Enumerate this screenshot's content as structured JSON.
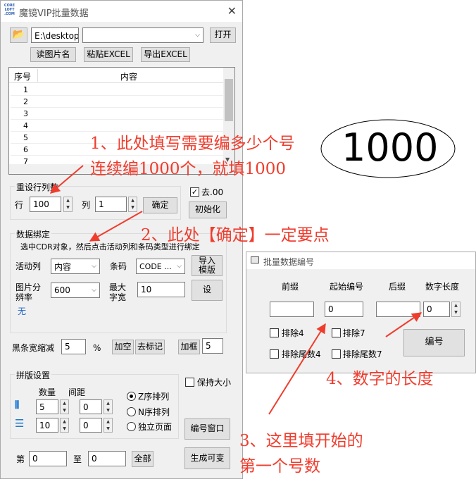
{
  "main_window": {
    "title": "魔镜VIP批量数据",
    "logo_text": "CORE LOFT .COM",
    "path_value": "E:\\desktop\\黑",
    "combo_value": "",
    "open_label": "打开",
    "read_image_name_label": "读图片名",
    "paste_excel_label": "粘贴EXCEL",
    "export_excel_label": "导出EXCEL",
    "table": {
      "col_index": "序号",
      "col_content": "内容",
      "rows": [
        "1",
        "2",
        "3",
        "4",
        "5",
        "6",
        "7"
      ]
    },
    "reset_rows_cols": {
      "group_label": "重设行列数",
      "row_label": "行",
      "row_value": "100",
      "col_label": "列",
      "col_value": "1",
      "confirm_label": "确定"
    },
    "remove_00_label": "去.00",
    "remove_00_checked": "✓",
    "init_label": "初始化",
    "data_binding": {
      "group_label": "数据绑定",
      "hint": "选中CDR对象，然后点击活动列和条码类型进行绑定",
      "active_col_label": "活动列",
      "active_col_value": "内容",
      "barcode_label": "条码",
      "barcode_value": "CODE ...",
      "import_template_label": "导入模版",
      "image_res_label": "图片分辨率",
      "image_res_value": "600",
      "max_width_label": "最大字宽",
      "max_width_value": "10",
      "set_label": "设",
      "none_text": "无"
    },
    "bar_shrink_label": "黑条宽缩减",
    "bar_shrink_value": "5",
    "percent": "%",
    "add_space_label": "加空",
    "remove_mark_label": "去标记",
    "add_frame_label": "加框",
    "add_frame_value": "5",
    "layout": {
      "group_label": "拼版设置",
      "qty_label": "数量",
      "spacing_label": "间距",
      "qty_h_value": "5",
      "qty_v_value": "10",
      "spacing_h_value": "0",
      "spacing_v_value": "0",
      "z_order_label": "Z序排列",
      "n_order_label": "N序排列",
      "single_page_label": "独立页面"
    },
    "keep_size_label": "保持大小",
    "numbering_window_label": "编号窗口",
    "from_label": "第",
    "from_value": "0",
    "to_label": "至",
    "to_value": "0",
    "all_label": "全部",
    "generate_label": "生成可变"
  },
  "numbering_window": {
    "title": "批量数据编号",
    "prefix_label": "前缀",
    "start_label": "起始编号",
    "suffix_label": "后缀",
    "digits_label": "数字长度",
    "prefix_value": "",
    "start_value": "0",
    "suffix_value": "",
    "digits_value": "0",
    "exclude4_label": "排除4",
    "exclude7_label": "排除7",
    "exclude_tail4_label": "排除尾数4",
    "exclude_tail7_label": "排除尾数7",
    "number_button_label": "编号"
  },
  "annotations": {
    "a1_line1": "1、此处填写需要编多少个号",
    "a1_line2": "连续编1000个，就填1000",
    "big_number": "1000",
    "a2": "2、此处【确定】一定要点",
    "a3_line1": "3、这里填开始的",
    "a3_line2": "第一个号数",
    "a4": "4、数字的长度"
  },
  "colors": {
    "annotation_red": "#f03c2d",
    "window_bg": "#f0f0f0",
    "none_text_blue": "#1e64c8",
    "layout_icon_blue": "#1e78d2"
  }
}
